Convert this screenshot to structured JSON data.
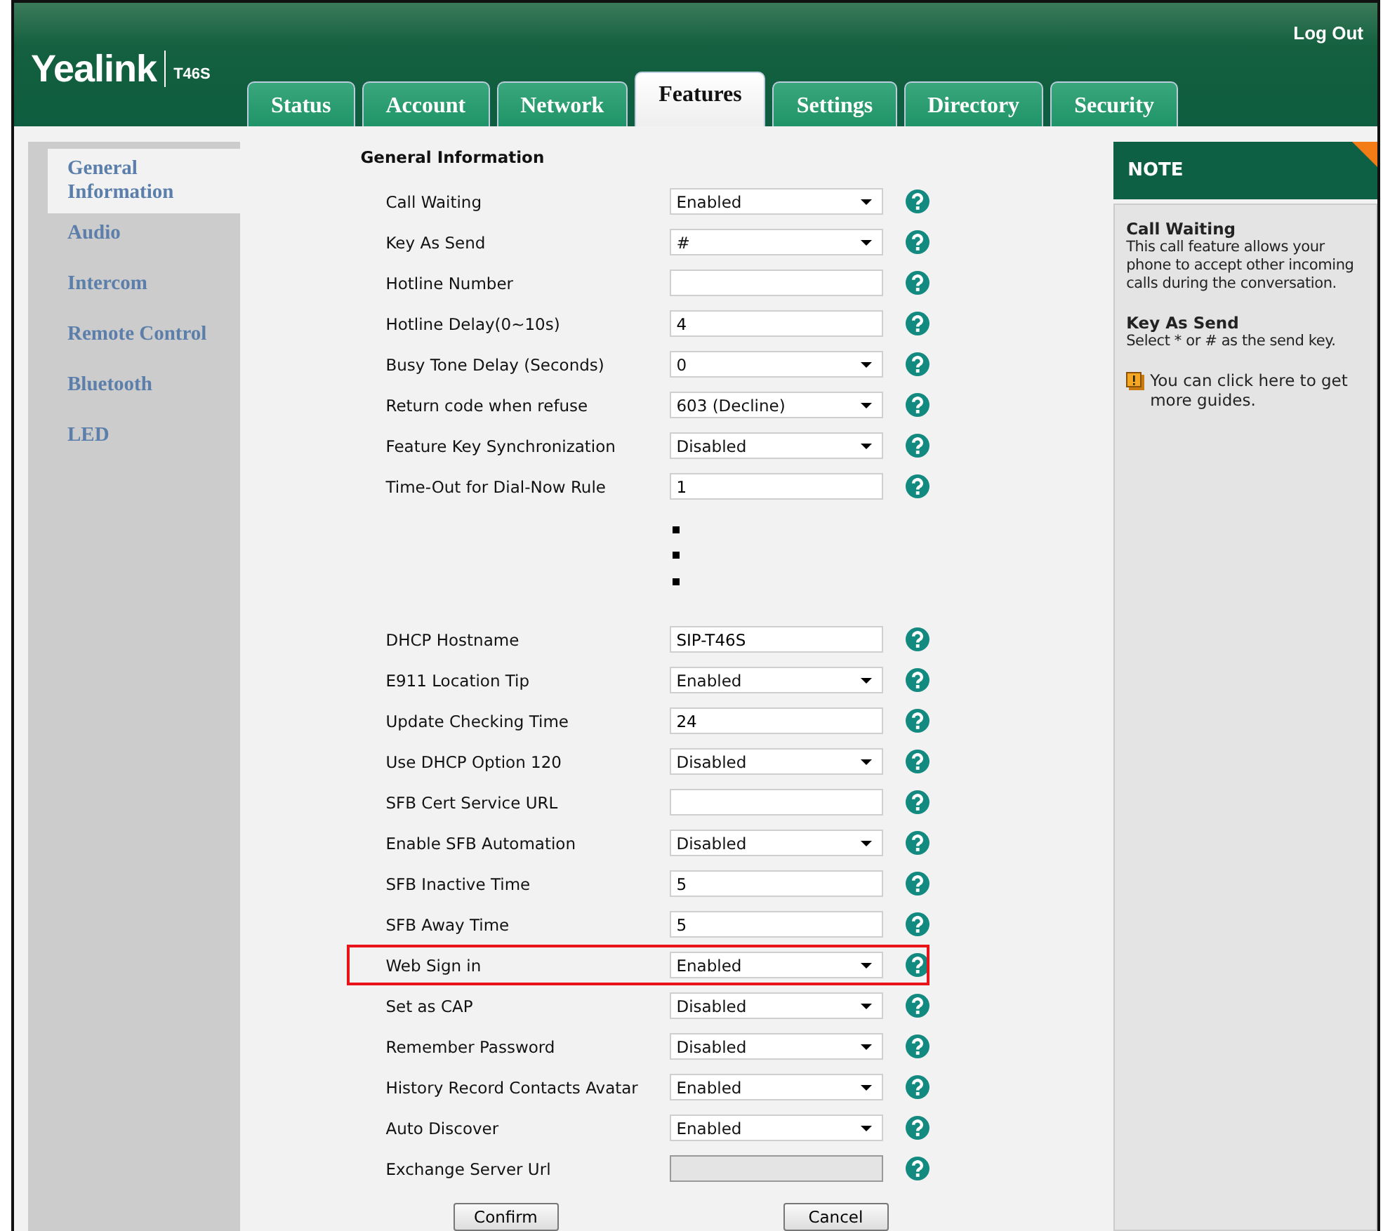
{
  "header": {
    "logo": "Yealink",
    "model": "T46S",
    "logout": "Log Out"
  },
  "tabs": [
    {
      "label": "Status",
      "selected": false
    },
    {
      "label": "Account",
      "selected": false
    },
    {
      "label": "Network",
      "selected": false
    },
    {
      "label": "Features",
      "selected": true
    },
    {
      "label": "Settings",
      "selected": false
    },
    {
      "label": "Directory",
      "selected": false
    },
    {
      "label": "Security",
      "selected": false
    }
  ],
  "sidebar": {
    "items": [
      {
        "label": "General Information",
        "selected": true
      },
      {
        "label": "Audio",
        "selected": false
      },
      {
        "label": "Intercom",
        "selected": false
      },
      {
        "label": "Remote Control",
        "selected": false
      },
      {
        "label": "Bluetooth",
        "selected": false
      },
      {
        "label": "LED",
        "selected": false
      }
    ]
  },
  "form": {
    "title": "General Information",
    "rows_top": [
      {
        "label": "Call Waiting",
        "kind": "select",
        "value": "Enabled",
        "highlighted": false
      },
      {
        "label": "Key As Send",
        "kind": "select",
        "value": "#",
        "highlighted": false
      },
      {
        "label": "Hotline Number",
        "kind": "text",
        "highlighted": false
      },
      {
        "label": "Hotline Delay(0~10s)",
        "kind": "text",
        "value": "4",
        "highlighted": false
      },
      {
        "label": "Busy Tone Delay (Seconds)",
        "kind": "select",
        "value": "0",
        "highlighted": false
      },
      {
        "label": "Return code when refuse",
        "kind": "select",
        "value": "603 (Decline)",
        "highlighted": false
      },
      {
        "label": "Feature Key Synchronization",
        "kind": "select",
        "value": "Disabled",
        "highlighted": false
      },
      {
        "label": "Time-Out for Dial-Now Rule",
        "kind": "text",
        "value": "1",
        "highlighted": false
      }
    ],
    "rows_bottom": [
      {
        "label": "DHCP Hostname",
        "kind": "text",
        "value": "SIP-T46S",
        "highlighted": false
      },
      {
        "label": "E911 Location Tip",
        "kind": "select",
        "value": "Enabled",
        "highlighted": false
      },
      {
        "label": "Update Checking Time",
        "kind": "text",
        "value": "24",
        "highlighted": false
      },
      {
        "label": "Use DHCP Option 120",
        "kind": "select",
        "value": "Disabled",
        "highlighted": false
      },
      {
        "label": "SFB Cert Service URL",
        "kind": "text",
        "highlighted": false
      },
      {
        "label": "Enable SFB Automation",
        "kind": "select",
        "value": "Disabled",
        "highlighted": false
      },
      {
        "label": "SFB Inactive Time",
        "kind": "text",
        "value": "5",
        "highlighted": false
      },
      {
        "label": "SFB Away Time",
        "kind": "text",
        "value": "5",
        "highlighted": false
      },
      {
        "label": "Web Sign in",
        "kind": "select",
        "value": "Enabled",
        "highlighted": true
      },
      {
        "label": "Set as CAP",
        "kind": "select",
        "value": "Disabled",
        "highlighted": false
      },
      {
        "label": "Remember Password",
        "kind": "select",
        "value": "Disabled",
        "highlighted": false
      },
      {
        "label": "History Record Contacts Avatar",
        "kind": "select",
        "value": "Enabled",
        "highlighted": false
      },
      {
        "label": "Auto Discover",
        "kind": "select",
        "value": "Enabled",
        "highlighted": false
      },
      {
        "label": "Exchange Server Url",
        "kind": "disabled",
        "highlighted": false
      }
    ],
    "buttons": [
      "Confirm",
      "Cancel"
    ]
  },
  "note": {
    "title": "NOTE",
    "entries": [
      {
        "heading": "Call Waiting",
        "text": "This call feature allows your phone to accept other incoming calls during the conversation."
      },
      {
        "heading": "Key As Send",
        "text": "Select * or # as the send key."
      }
    ],
    "guide": "You can click here to get more guides."
  }
}
